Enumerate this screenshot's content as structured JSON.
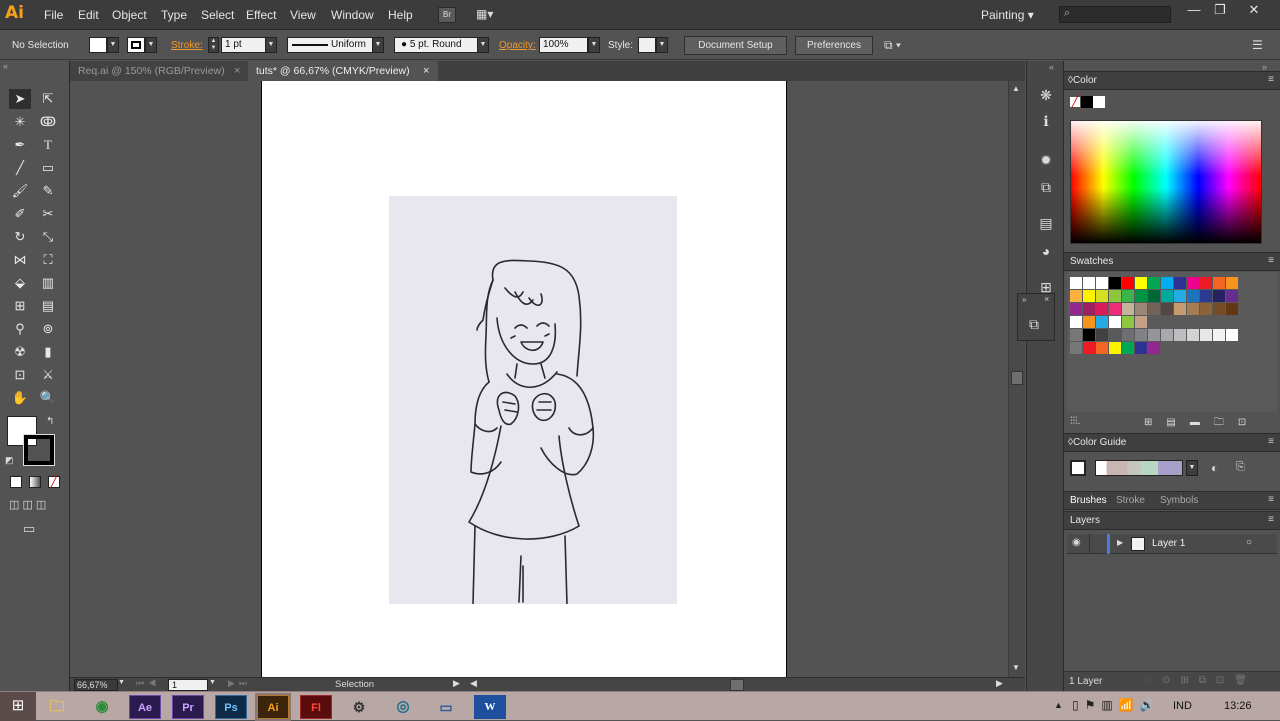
{
  "app": {
    "logo": "Ai",
    "workspace": "Painting"
  },
  "menu": {
    "items": [
      "File",
      "Edit",
      "Object",
      "Type",
      "Select",
      "Effect",
      "View",
      "Window",
      "Help"
    ]
  },
  "window_controls": {
    "minimize": "—",
    "restore": "❐",
    "close": "✕"
  },
  "control_bar": {
    "selection_status": "No Selection",
    "stroke_label": "Stroke:",
    "stroke_weight": "1 pt",
    "stroke_profile": "Uniform",
    "brush": "5 pt. Round",
    "opacity_label": "Opacity:",
    "opacity_value": "100%",
    "style_label": "Style:",
    "document_setup": "Document Setup",
    "preferences": "Preferences"
  },
  "tabs": [
    {
      "label": "Req.ai @ 150% (RGB/Preview)",
      "active": false
    },
    {
      "label": "tuts* @ 66,67% (CMYK/Preview)",
      "active": true
    }
  ],
  "status_bar": {
    "zoom": "66,67%",
    "artboard": "1",
    "tool": "Selection"
  },
  "panels": {
    "color": "Color",
    "swatches": "Swatches",
    "color_guide": "Color Guide",
    "brushes": "Brushes",
    "stroke": "Stroke",
    "symbols": "Symbols",
    "layers": "Layers",
    "layer_name": "Layer 1",
    "layer_count": "1 Layer"
  },
  "taskbar": {
    "apps": [
      "Ae",
      "Pr",
      "Ps",
      "Ai",
      "Fl",
      "W"
    ],
    "language": "IND",
    "clock": "13:26"
  },
  "colors": {
    "accent": "#ef9a2e",
    "illustrator_brand": "#f7a21b",
    "layer_color": "#4b7bd9"
  }
}
